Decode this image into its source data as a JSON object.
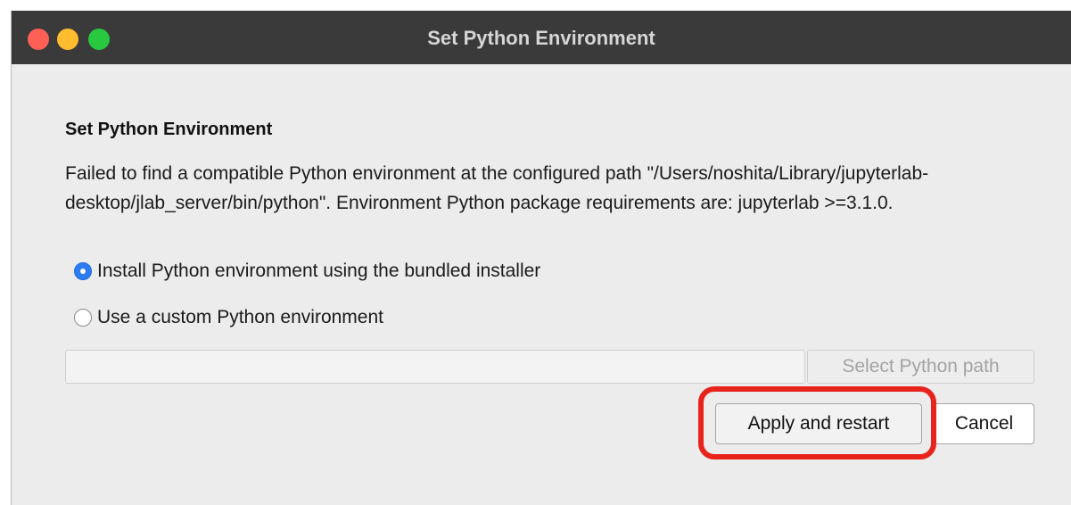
{
  "window": {
    "title": "Set Python Environment",
    "traffic_lights": {
      "close": "#fe5f57",
      "minimize": "#febc2e",
      "maximize": "#28c840"
    }
  },
  "dialog": {
    "heading": "Set Python Environment",
    "message": "Failed to find a compatible Python environment at the configured path \"/Users/noshita/Library/jupyterlab-desktop/jlab_server/bin/python\". Environment Python package requirements are: jupyterlab >=3.1.0.",
    "options": [
      {
        "label": "Install Python environment using the bundled installer",
        "selected": true
      },
      {
        "label": "Use a custom Python environment",
        "selected": false
      }
    ],
    "path_input": {
      "value": "",
      "placeholder": ""
    },
    "select_path_label": "Select Python path",
    "apply_label": "Apply and restart",
    "cancel_label": "Cancel"
  },
  "annotation": {
    "highlight_color": "#e8231b",
    "highlighted": "apply-restart-button"
  }
}
